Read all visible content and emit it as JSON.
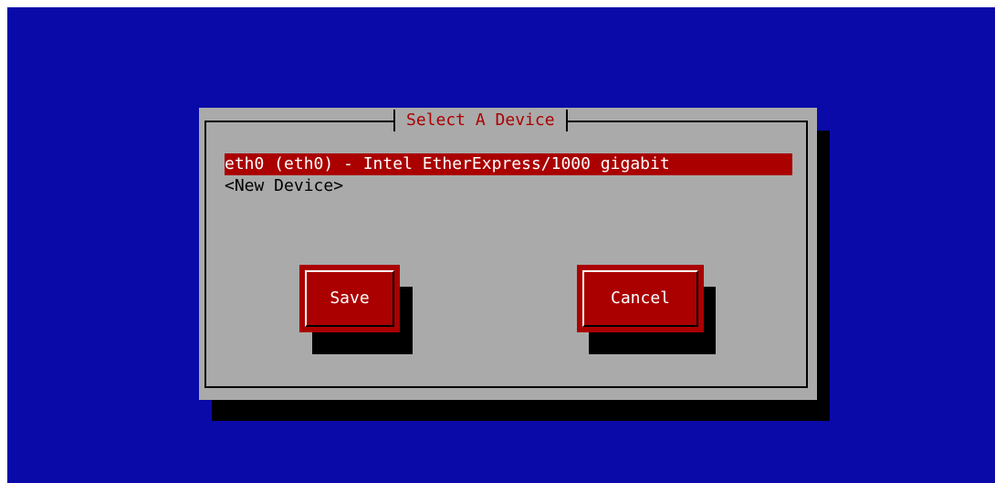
{
  "dialog": {
    "title": "Select A Device"
  },
  "devices": [
    {
      "label": "eth0 (eth0) - Intel EtherExpress/1000 gigabit",
      "selected": true
    },
    {
      "label": "<New Device>",
      "selected": false
    }
  ],
  "buttons": {
    "save_label": "Save",
    "cancel_label": "Cancel"
  },
  "colors": {
    "background": "#0a0aa8",
    "dialog": "#aaaaaa",
    "accent": "#aa0000",
    "shadow": "#000000"
  }
}
